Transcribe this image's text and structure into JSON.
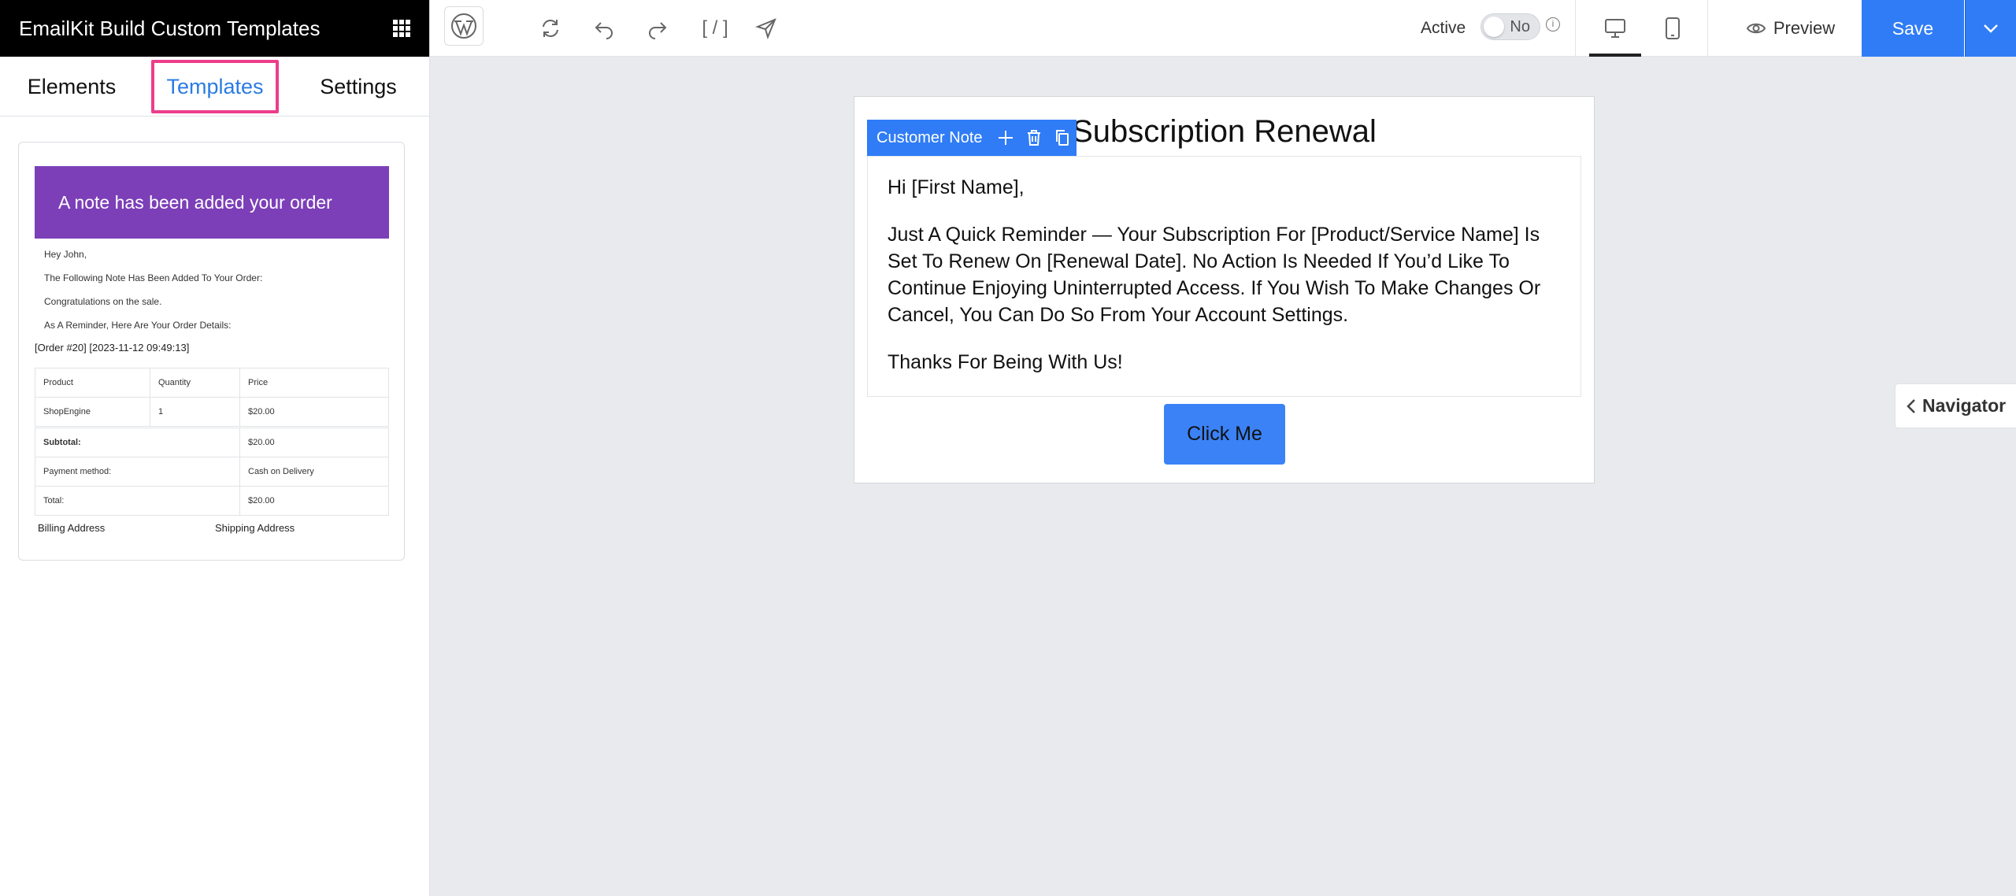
{
  "app": {
    "title": "EmailKit Build Custom Templates"
  },
  "sidebar": {
    "tabs": [
      {
        "label": "Elements"
      },
      {
        "label": "Templates"
      },
      {
        "label": "Settings"
      }
    ],
    "template_card": {
      "header": "A note has been added your order",
      "lines": [
        "Hey John,",
        "The Following Note Has Been Added To Your Order:",
        "Congratulations on the sale.",
        "As A Reminder, Here Are Your Order Details:"
      ],
      "order_ref": "[Order #20] [2023-11-12 09:49:13]",
      "table_headers": [
        "Product",
        "Quantity",
        "Price"
      ],
      "table_row": [
        "ShopEngine",
        "1",
        "$20.00"
      ],
      "totals": [
        {
          "label": "Subtotal:",
          "value": "$20.00"
        },
        {
          "label": "Payment method:",
          "value": "Cash on Delivery"
        },
        {
          "label": "Total:",
          "value": "$20.00"
        }
      ],
      "billing_address": "Billing Address",
      "shipping_address": "Shipping Address"
    }
  },
  "toolbar": {
    "active_label": "Active",
    "toggle_value": "No",
    "preview_label": "Preview",
    "save_label": "Save",
    "accent_color": "#2f7cf6"
  },
  "canvas": {
    "title": "Subscription Renewal",
    "note_toolbar_label": "Customer Note",
    "paragraphs": [
      "Hi [First Name],",
      "Just A Quick Reminder — Your Subscription For [Product/Service Name] Is Set To Renew On [Renewal Date]. No Action Is Needed If You’d Like To Continue Enjoying Uninterrupted Access. If You Wish To Make Changes Or Cancel, You Can Do So From Your Account Settings.",
      "Thanks For Being With Us!"
    ],
    "button_label": "Click Me"
  },
  "navigator": {
    "label": "Navigator"
  }
}
